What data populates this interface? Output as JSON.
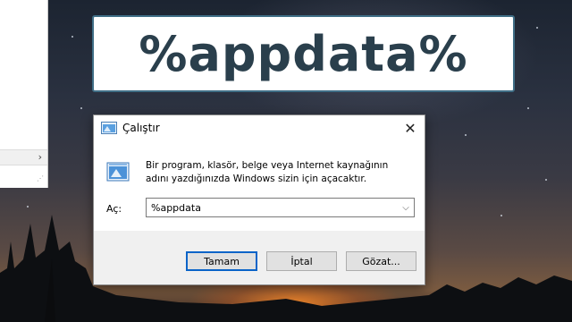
{
  "banner": {
    "text": "%appdata%"
  },
  "explorer": {
    "scroll_arrow": "›"
  },
  "dialog": {
    "title": "Çalıştır",
    "close_glyph": "✕",
    "description": "Bir program, klasör, belge veya Internet kaynağının adını yazdığınızda Windows sizin için açacaktır.",
    "open_label": "Aç:",
    "input_value": "%appdata",
    "dropdown_glyph": "⌵",
    "buttons": {
      "ok": "Tamam",
      "cancel": "İptal",
      "browse": "Gözat..."
    }
  },
  "colors": {
    "banner_border": "#3f6e86",
    "banner_text": "#2a3f4c",
    "ok_border": "#0a64c8"
  },
  "icons": [
    "run-app-icon",
    "run-icon",
    "close-icon",
    "chevron-down-icon",
    "chevron-right-icon"
  ]
}
